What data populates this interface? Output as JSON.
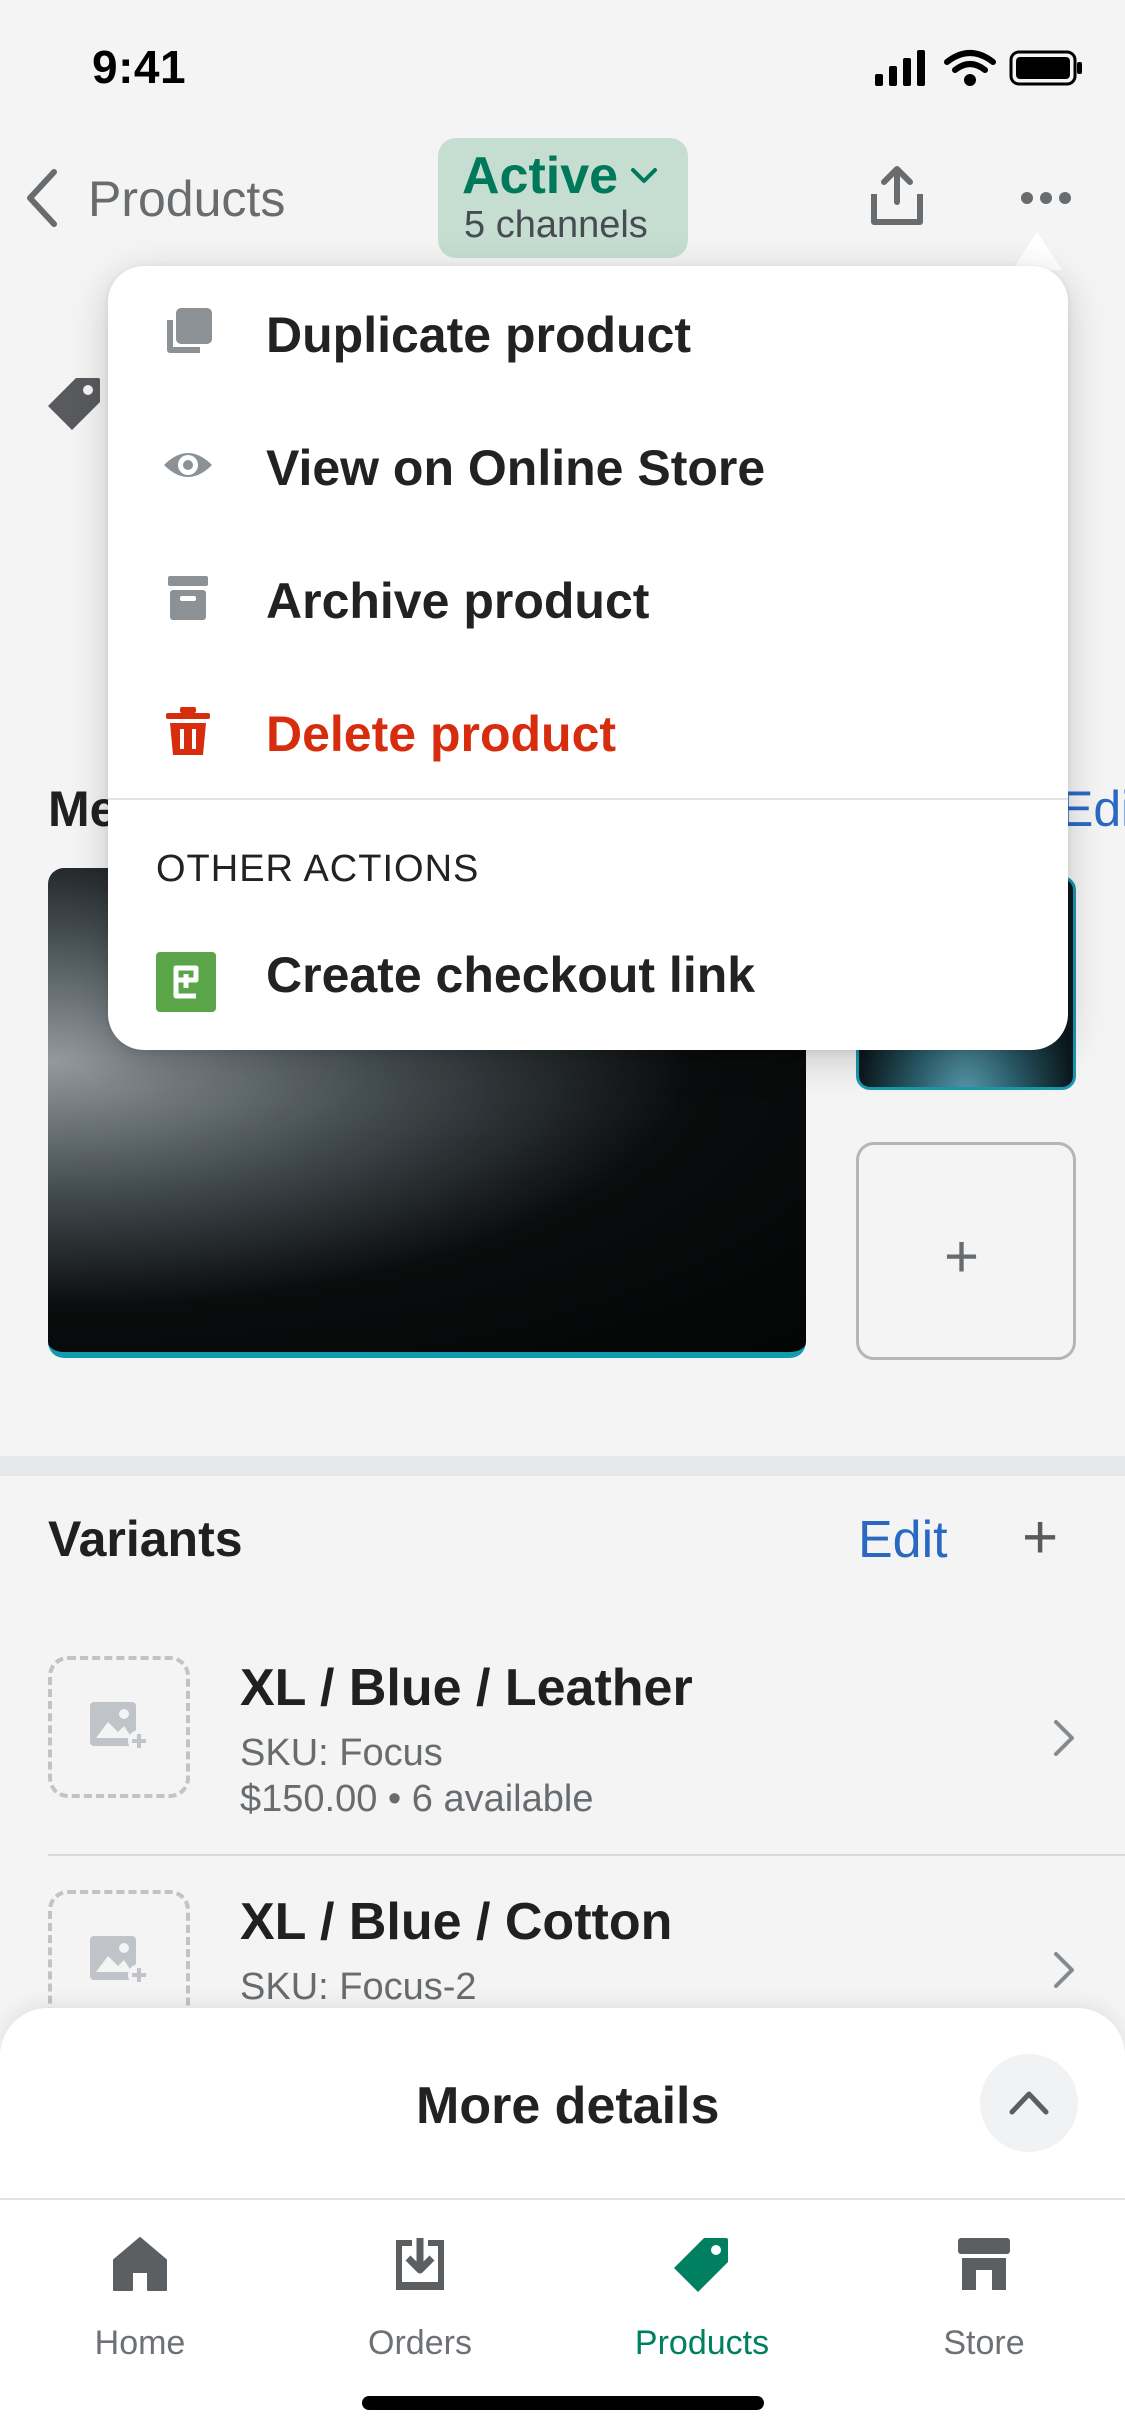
{
  "status_bar": {
    "time": "9:41"
  },
  "nav": {
    "back_label": "Products",
    "status_title": "Active",
    "status_subtitle": "5 channels"
  },
  "media": {
    "title": "Media",
    "edit_label": "Edit",
    "add_label": "+"
  },
  "variants": {
    "title": "Variants",
    "edit_label": "Edit",
    "add_label": "+",
    "items": [
      {
        "title": "XL / Blue / Leather",
        "sku": "SKU: Focus",
        "meta": "$150.00 • 6 available"
      },
      {
        "title": "XL / Blue / Cotton",
        "sku": "SKU: Focus-2"
      }
    ]
  },
  "menu": {
    "items": [
      {
        "label": "Duplicate product",
        "icon": "duplicate-icon"
      },
      {
        "label": "View on Online Store",
        "icon": "eye-icon"
      },
      {
        "label": "Archive product",
        "icon": "archive-icon"
      },
      {
        "label": "Delete product",
        "icon": "trash-icon"
      }
    ],
    "section_title": "OTHER ACTIONS",
    "other_items": [
      {
        "label": "Create checkout link",
        "icon": "checkout-link-app-icon"
      }
    ]
  },
  "sheet": {
    "title": "More details"
  },
  "tabs": [
    {
      "label": "Home",
      "icon": "home-icon"
    },
    {
      "label": "Orders",
      "icon": "orders-icon"
    },
    {
      "label": "Products",
      "icon": "products-tag-icon",
      "active": true
    },
    {
      "label": "Store",
      "icon": "store-icon"
    }
  ],
  "colors": {
    "brand_green": "#008060",
    "danger": "#d72c0d",
    "link_blue": "#2c6ecb",
    "pill_bg": "#cfe8dc"
  }
}
